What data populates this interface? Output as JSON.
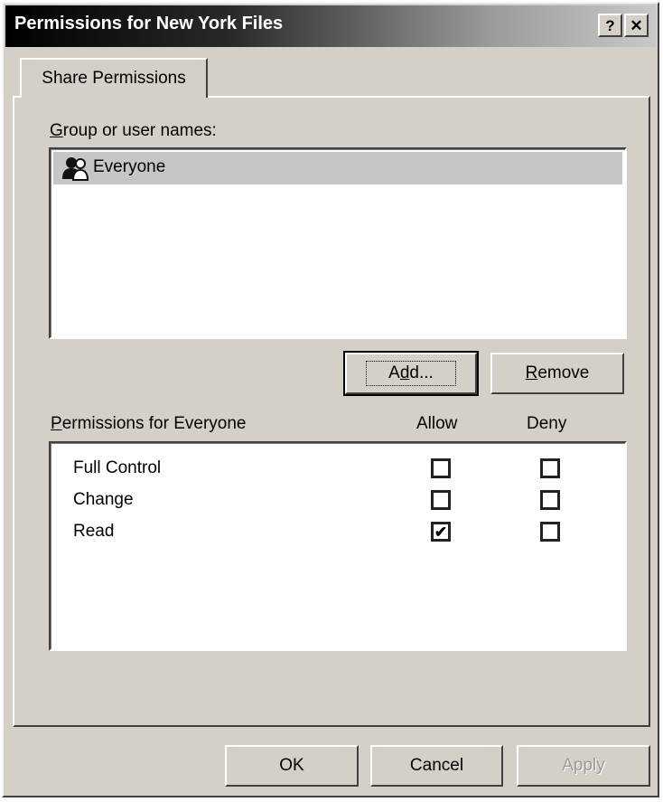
{
  "window": {
    "title": "Permissions for New York Files",
    "help_label": "?",
    "close_label": "✕"
  },
  "tab": {
    "label": "Share Permissions"
  },
  "group_section": {
    "label_hotkey": "G",
    "label_rest": "roup or user names:",
    "users": [
      {
        "name": "Everyone",
        "icon": "group-icon",
        "selected": true
      }
    ]
  },
  "buttons": {
    "add_hotkey": "d",
    "add_pre": "A",
    "add_post": "d...",
    "remove_hotkey": "R",
    "remove_rest": "emove",
    "ok": "OK",
    "cancel": "Cancel",
    "apply": "Apply"
  },
  "permissions": {
    "label_hotkey": "P",
    "label_rest": "ermissions for Everyone",
    "allow_header": "Allow",
    "deny_header": "Deny",
    "rows": [
      {
        "name": "Full Control",
        "allow": false,
        "deny": false
      },
      {
        "name": "Change",
        "allow": false,
        "deny": false
      },
      {
        "name": "Read",
        "allow": true,
        "deny": false
      }
    ]
  }
}
